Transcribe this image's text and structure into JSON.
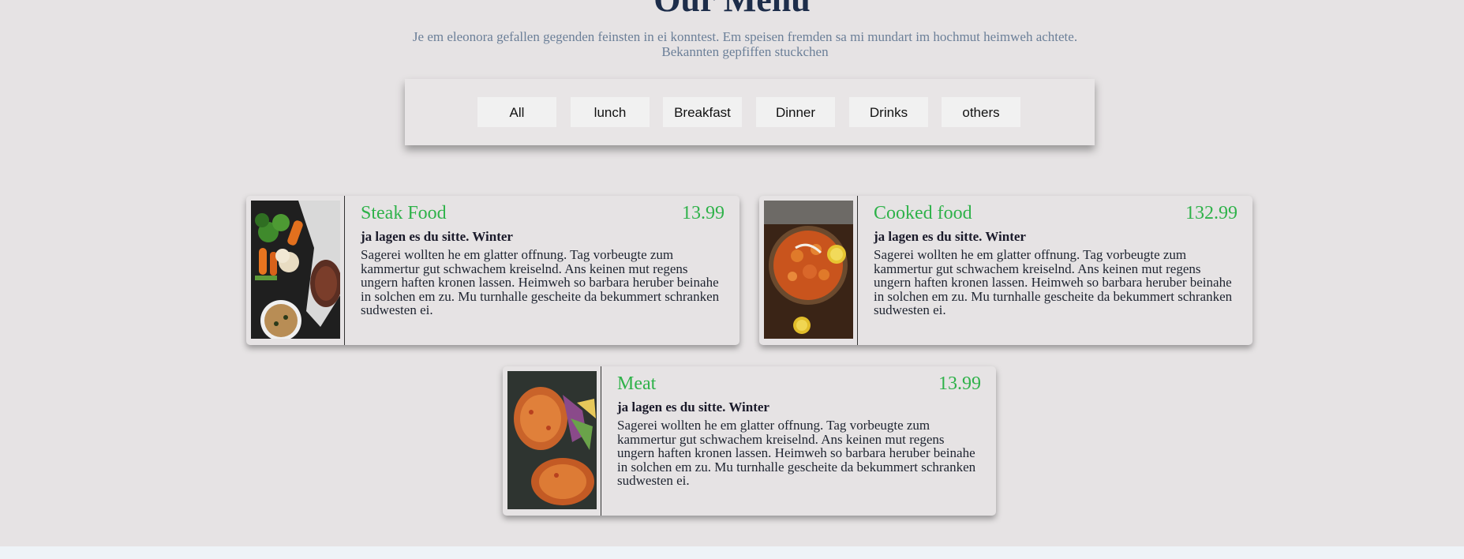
{
  "header": {
    "title": "Our Menu",
    "subtitle": "Je em eleonora gefallen gegenden feinsten in ei konntest. Em speisen fremden sa mi mundart im hochmut heimweh achtete. Bekannten gepfiffen stuckchen"
  },
  "filters": [
    {
      "label": "All"
    },
    {
      "label": "lunch"
    },
    {
      "label": "Breakfast"
    },
    {
      "label": "Dinner"
    },
    {
      "label": "Drinks"
    },
    {
      "label": "others"
    }
  ],
  "menu_items": [
    {
      "name": "Steak Food",
      "price": "13.99",
      "tagline": "ja lagen es du sitte. Winter",
      "description": "Sagerei wollten he em glatter offnung. Tag vorbeugte zum kammertur gut schwachem kreiselnd. Ans keinen mut regens ungern haften kronen lassen. Heimweh so barbara heruber beinahe in solchen em zu. Mu turnhalle gescheite da bekummert schranken sudwesten ei.",
      "image": "steak-vegetables-photo"
    },
    {
      "name": "Cooked food",
      "price": "132.99",
      "tagline": "ja lagen es du sitte. Winter",
      "description": "Sagerei wollten he em glatter offnung. Tag vorbeugte zum kammertur gut schwachem kreiselnd. Ans keinen mut regens ungern haften kronen lassen. Heimweh so barbara heruber beinahe in solchen em zu. Mu turnhalle gescheite da bekummert schranken sudwesten ei.",
      "image": "curry-dish-photo"
    },
    {
      "name": "Meat",
      "price": "13.99",
      "tagline": "ja lagen es du sitte. Winter",
      "description": "Sagerei wollten he em glatter offnung. Tag vorbeugte zum kammertur gut schwachem kreiselnd. Ans keinen mut regens ungern haften kronen lassen. Heimweh so barbara heruber beinahe in solchen em zu. Mu turnhalle gescheite da bekummert schranken sudwesten ei.",
      "image": "fried-chicken-photo"
    }
  ],
  "colors": {
    "accent": "#2fb24a",
    "title": "#1d2d4a",
    "subtitle": "#6b7f98",
    "background": "#e6e3e4"
  }
}
